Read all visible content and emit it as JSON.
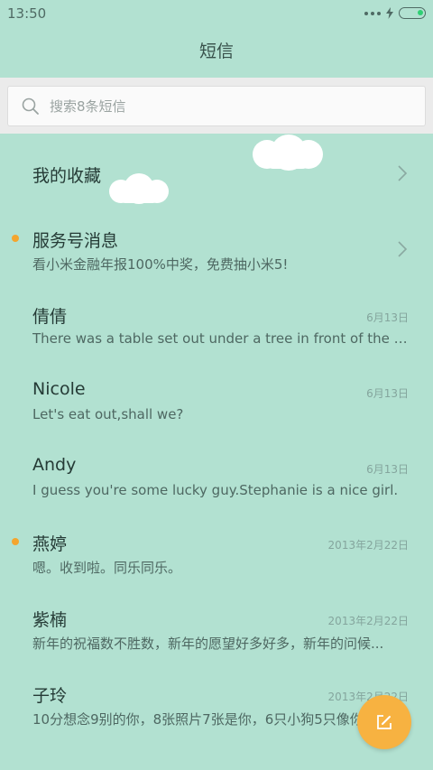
{
  "status_bar": {
    "time": "13:50"
  },
  "header": {
    "title": "短信"
  },
  "search": {
    "placeholder": "搜索8条短信"
  },
  "conversations": [
    {
      "name": "我的收藏",
      "preview": "",
      "date": "",
      "unread": false,
      "chevron": true
    },
    {
      "name": "服务号消息",
      "preview": "看小米金融年报100%中奖，免费抽小米5!",
      "date": "",
      "unread": true,
      "chevron": true
    },
    {
      "name": "倩倩",
      "preview": "There was a table set out under a tree in front of the ho...",
      "date": "6月13日",
      "unread": false
    },
    {
      "name": "Nicole",
      "preview": "Let's eat out,shall we?",
      "date": "6月13日",
      "unread": false
    },
    {
      "name": "Andy",
      "preview": "I guess you're some lucky guy.Stephanie is a nice girl.",
      "date": "6月13日",
      "unread": false
    },
    {
      "name": "燕婷",
      "preview": "嗯。收到啦。同乐同乐。",
      "date": "2013年2月22日",
      "unread": true
    },
    {
      "name": "紫楠",
      "preview": "新年的祝福数不胜数，新年的愿望好多好多，新年的问候...",
      "date": "2013年2月22日",
      "unread": false
    },
    {
      "name": "子玲",
      "preview": "10分想念9别的你，8张照片7张是你，6只小狗5只像你",
      "date": "2013年2月22日",
      "unread": false
    }
  ],
  "icons": {
    "search": "search-icon",
    "chevron": "chevron-right-icon",
    "compose": "compose-icon",
    "battery": "battery-icon",
    "more": "more-dots-icon",
    "charging": "lightning-icon"
  },
  "colors": {
    "background": "#b2e1d1",
    "accent": "#f7b241",
    "unread_dot": "#f4a52e"
  }
}
